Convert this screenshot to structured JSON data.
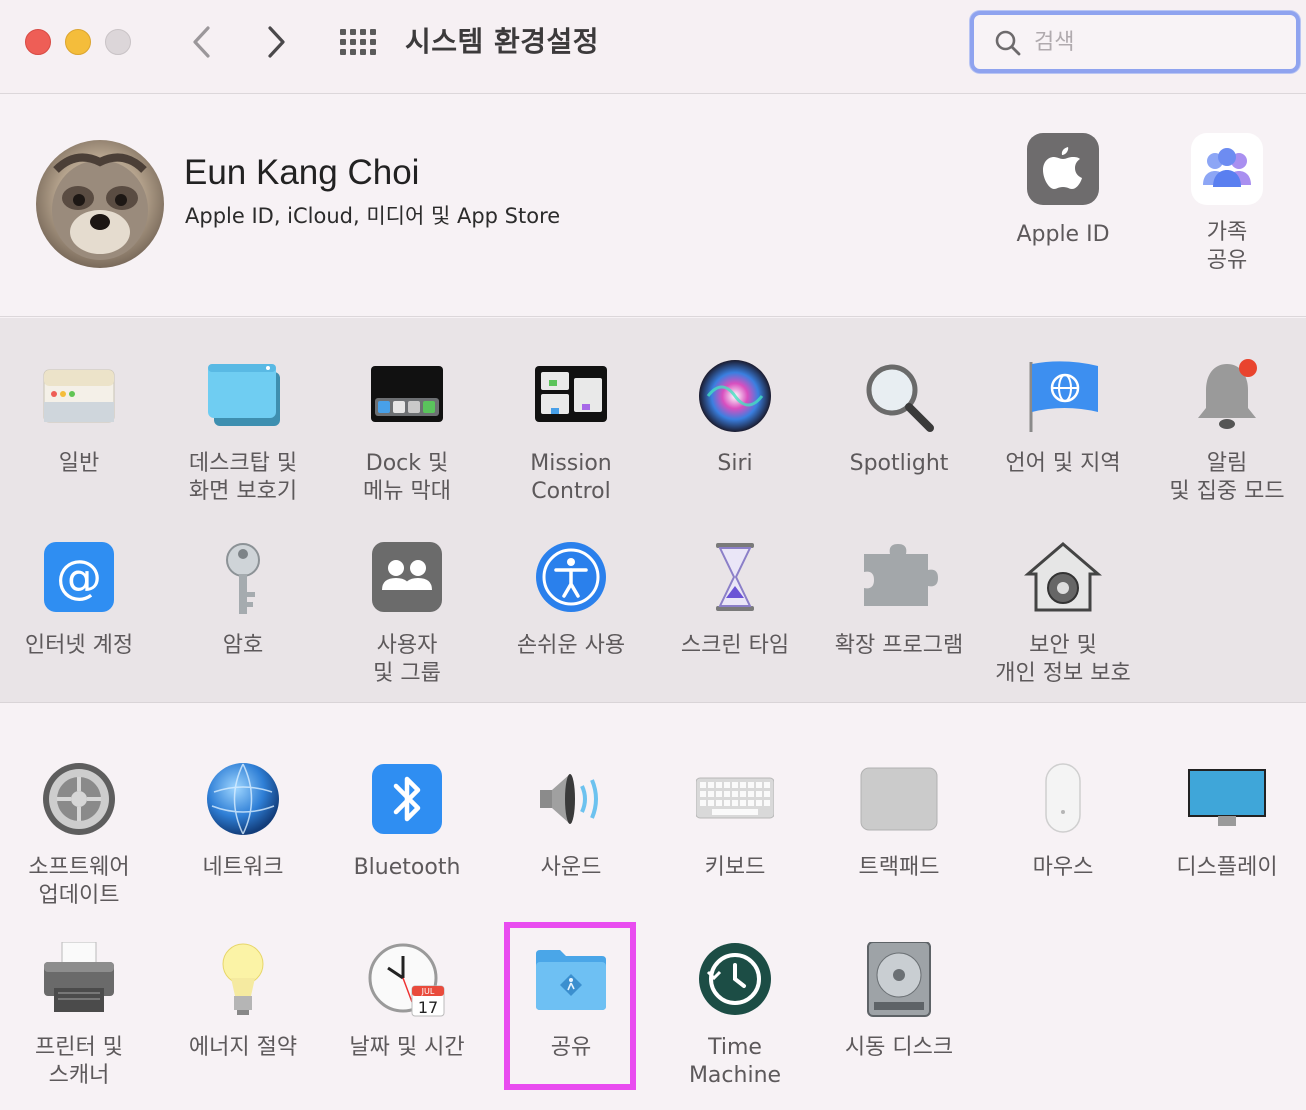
{
  "window": {
    "title": "시스템 환경설정",
    "search_placeholder": "검색"
  },
  "account": {
    "name": "Eun Kang Choi",
    "subtitle": "Apple ID, iCloud, 미디어 및 App Store",
    "apple_id_label": "Apple ID",
    "family_label": "가족\n공유"
  },
  "panes_a": [
    {
      "label": "일반",
      "icon": "general-icon"
    },
    {
      "label": "데스크탑 및\n화면 보호기",
      "icon": "desktop-icon"
    },
    {
      "label": "Dock 및\n메뉴 막대",
      "icon": "dock-icon"
    },
    {
      "label": "Mission\nControl",
      "icon": "mission-control-icon"
    },
    {
      "label": "Siri",
      "icon": "siri-icon"
    },
    {
      "label": "Spotlight",
      "icon": "spotlight-icon"
    },
    {
      "label": "언어 및 지역",
      "icon": "language-region-icon"
    },
    {
      "label": "알림\n및 집중 모드",
      "icon": "notifications-icon"
    },
    {
      "label": "인터넷 계정",
      "icon": "internet-accounts-icon"
    },
    {
      "label": "암호",
      "icon": "passwords-icon"
    },
    {
      "label": "사용자\n및 그룹",
      "icon": "users-groups-icon"
    },
    {
      "label": "손쉬운 사용",
      "icon": "accessibility-icon"
    },
    {
      "label": "스크린 타임",
      "icon": "screen-time-icon"
    },
    {
      "label": "확장 프로그램",
      "icon": "extensions-icon"
    },
    {
      "label": "보안 및\n개인 정보 보호",
      "icon": "security-privacy-icon"
    }
  ],
  "panes_b": [
    {
      "label": "소프트웨어\n업데이트",
      "icon": "software-update-icon"
    },
    {
      "label": "네트워크",
      "icon": "network-icon"
    },
    {
      "label": "Bluetooth",
      "icon": "bluetooth-icon"
    },
    {
      "label": "사운드",
      "icon": "sound-icon"
    },
    {
      "label": "키보드",
      "icon": "keyboard-icon"
    },
    {
      "label": "트랙패드",
      "icon": "trackpad-icon"
    },
    {
      "label": "마우스",
      "icon": "mouse-icon"
    },
    {
      "label": "디스플레이",
      "icon": "displays-icon"
    },
    {
      "label": "프린터 및\n스캐너",
      "icon": "printers-scanners-icon"
    },
    {
      "label": "에너지 절약",
      "icon": "energy-saver-icon"
    },
    {
      "label": "날짜 및 시간",
      "icon": "date-time-icon"
    },
    {
      "label": "공유",
      "icon": "sharing-icon"
    },
    {
      "label": "Time\nMachine",
      "icon": "time-machine-icon"
    },
    {
      "label": "시동 디스크",
      "icon": "startup-disk-icon"
    }
  ],
  "date_icon": {
    "month": "JUL",
    "day": "17"
  },
  "colors": {
    "highlight": "#e94cf0",
    "search_focus": "#8fa3ef"
  }
}
